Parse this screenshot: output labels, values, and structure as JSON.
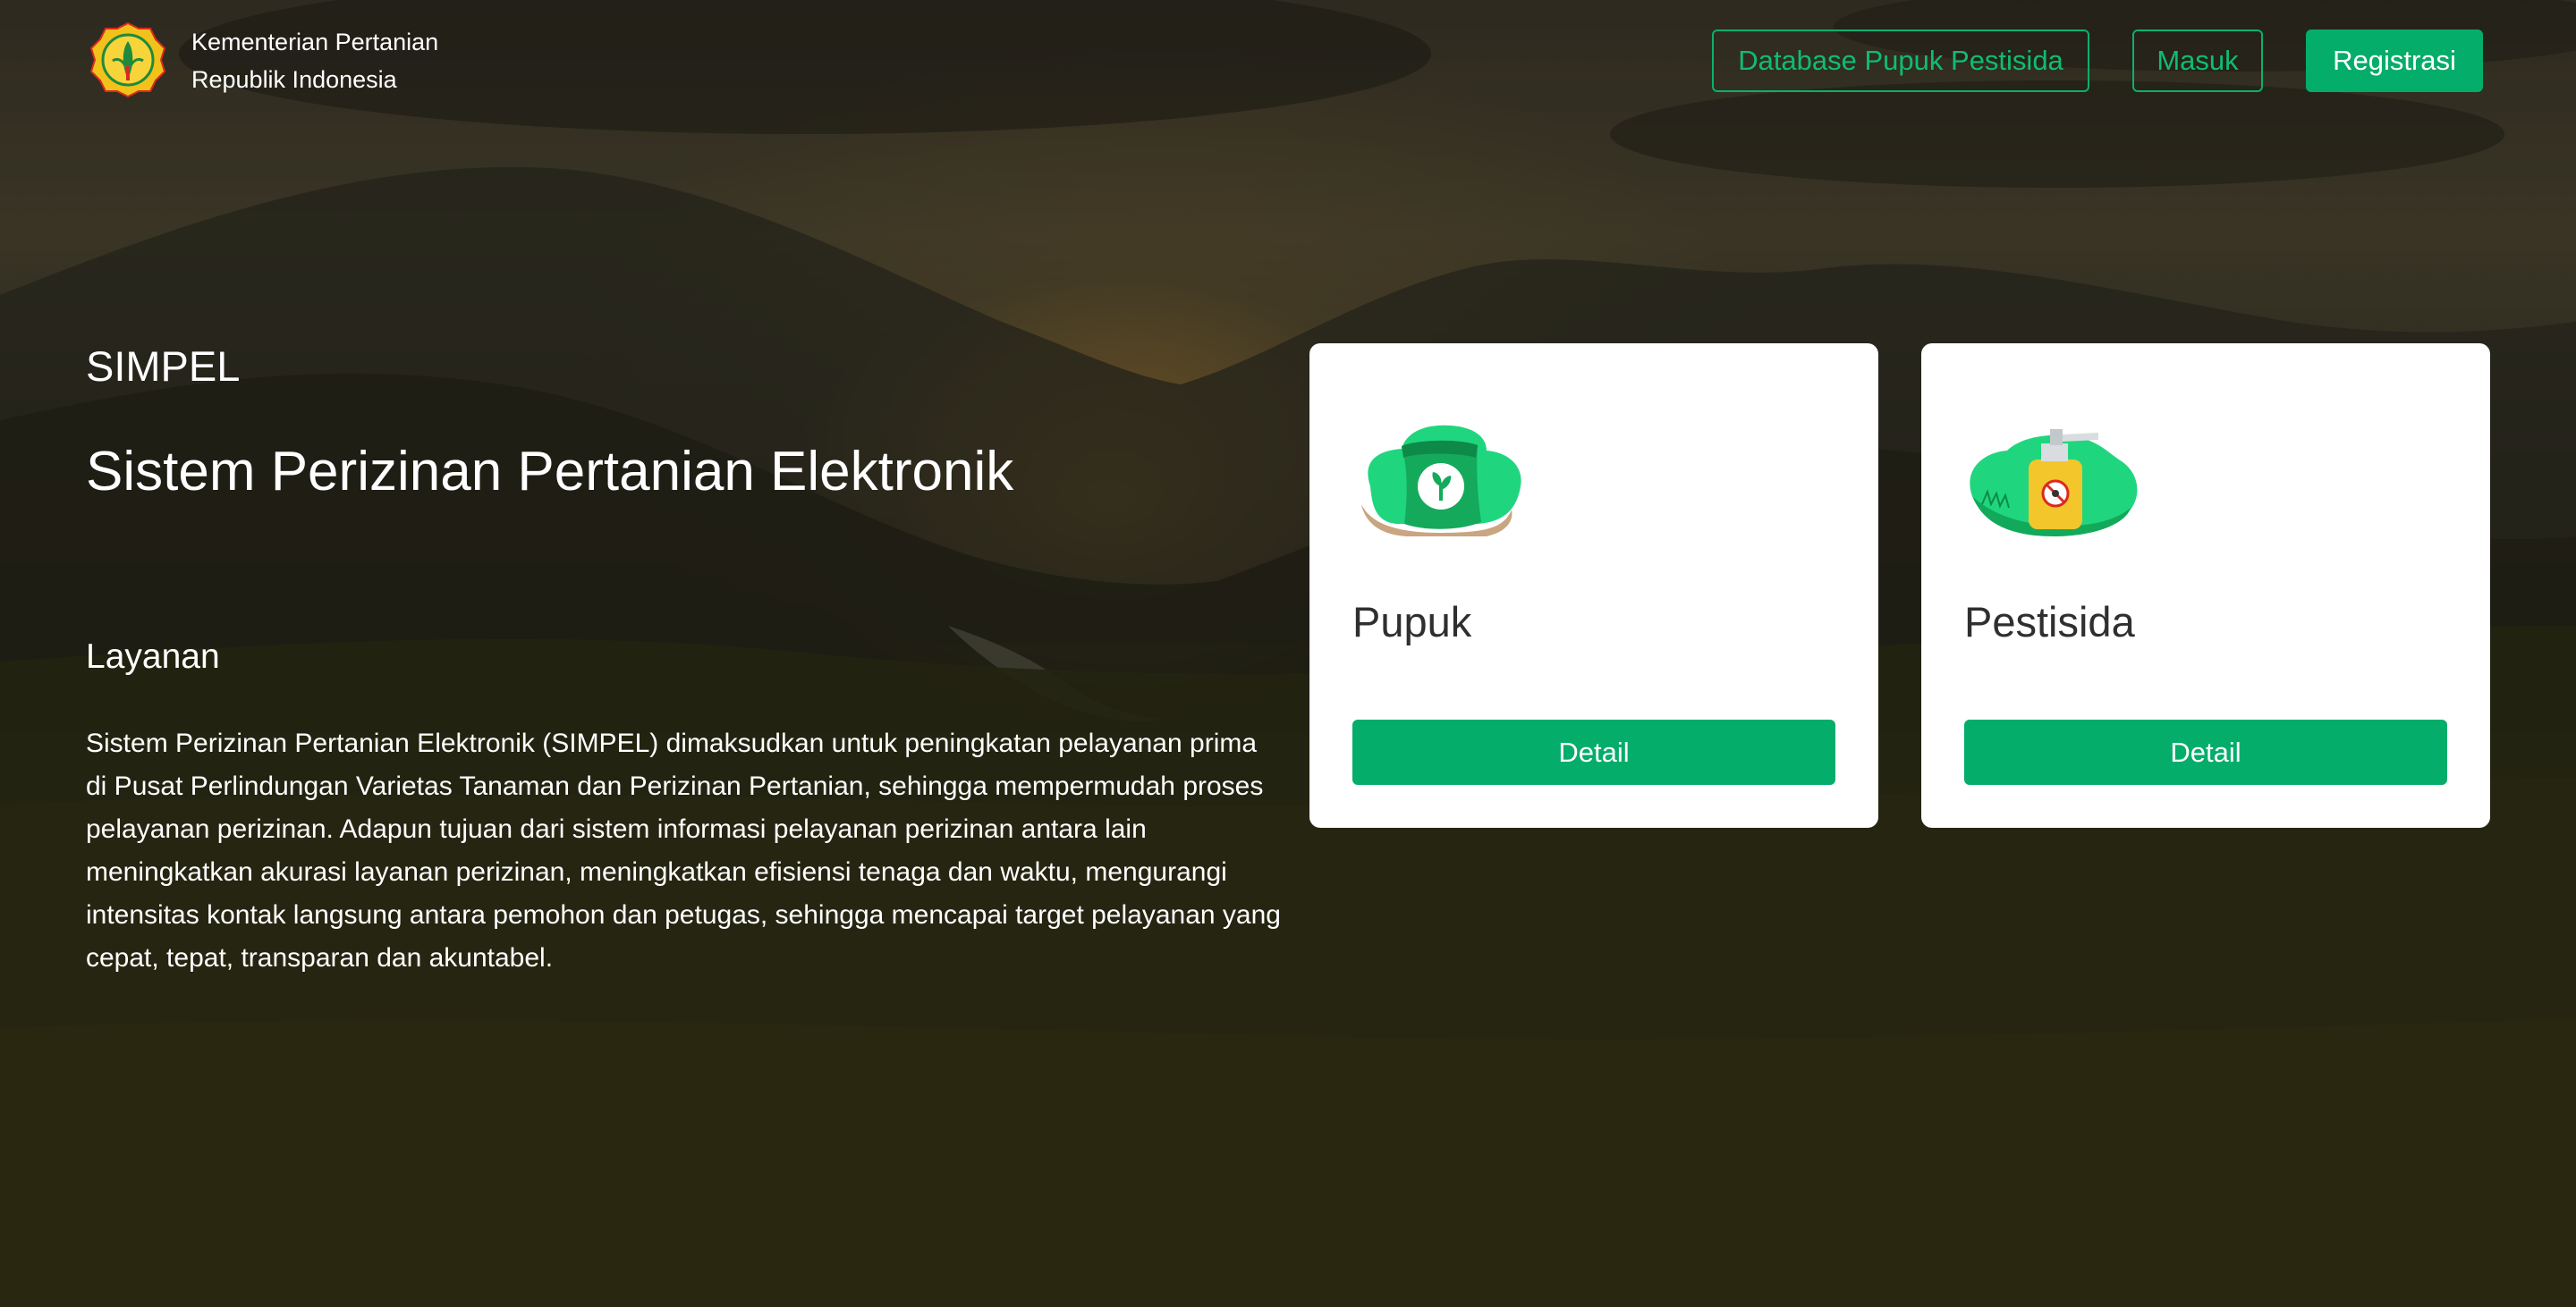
{
  "header": {
    "org_line1": "Kementerian Pertanian",
    "org_line2": "Republik Indonesia",
    "nav": {
      "database_label": "Database Pupuk Pestisida",
      "login_label": "Masuk",
      "register_label": "Registrasi"
    }
  },
  "hero": {
    "abbr": "SIMPEL",
    "title": "Sistem Perizinan Pertanian Elektronik",
    "section_title": "Layanan",
    "description": "Sistem Perizinan Pertanian Elektronik (SIMPEL) dimaksudkan untuk peningkatan pelayanan prima di Pusat Perlindungan Varietas Tanaman dan Perizinan Pertanian, sehingga mempermudah proses pelayanan perizinan. Adapun tujuan dari sistem informasi pelayanan perizinan antara lain meningkatkan akurasi layanan perizinan, meningkatkan efisiensi tenaga dan waktu, mengurangi intensitas kontak langsung antara pemohon dan petugas, sehingga mencapai target pelayanan yang cepat, tepat, transparan dan akuntabel."
  },
  "cards": [
    {
      "title": "Pupuk",
      "icon": "fertilizer-bag-icon",
      "button_label": "Detail"
    },
    {
      "title": "Pestisida",
      "icon": "pesticide-sprayer-icon",
      "button_label": "Detail"
    }
  ],
  "colors": {
    "accent": "#05ad6a",
    "accent_text": "#0fbd72",
    "card_bg": "#ffffff",
    "card_title": "#2f2f2f"
  }
}
